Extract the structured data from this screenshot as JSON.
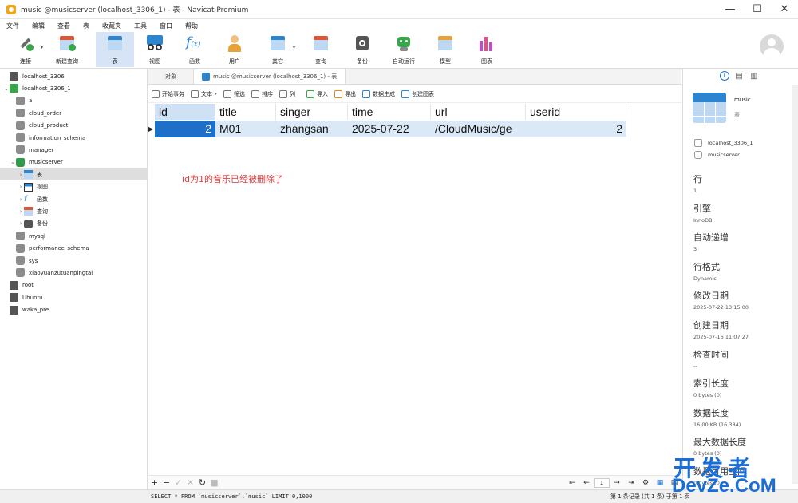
{
  "window": {
    "title": "music @musicserver (localhost_3306_1) - 表 - Navicat Premium"
  },
  "menu": [
    "文件",
    "编辑",
    "查看",
    "表",
    "收藏夹",
    "工具",
    "窗口",
    "帮助"
  ],
  "toolbar": [
    {
      "label": "连接",
      "icon": "connect-icon",
      "dropdown": true
    },
    {
      "label": "新建查询",
      "icon": "new-query-icon"
    },
    {
      "label": "表",
      "icon": "table-icon",
      "active": true
    },
    {
      "label": "视图",
      "icon": "view-icon"
    },
    {
      "label": "函数",
      "icon": "function-icon"
    },
    {
      "label": "用户",
      "icon": "user-icon"
    },
    {
      "label": "其它",
      "icon": "tools-icon",
      "dropdown": true
    },
    {
      "label": "查询",
      "icon": "query-icon"
    },
    {
      "label": "备份",
      "icon": "backup-icon"
    },
    {
      "label": "自动运行",
      "icon": "robot-icon"
    },
    {
      "label": "模型",
      "icon": "model-icon"
    },
    {
      "label": "图表",
      "icon": "chart-icon"
    }
  ],
  "tree": [
    {
      "label": "localhost_3306",
      "type": "conn",
      "indent": 0
    },
    {
      "label": "localhost_3306_1",
      "type": "conn-open",
      "indent": 0,
      "chev": "⌄"
    },
    {
      "label": "a",
      "type": "db",
      "indent": 1
    },
    {
      "label": "cloud_order",
      "type": "db",
      "indent": 1
    },
    {
      "label": "cloud_product",
      "type": "db",
      "indent": 1
    },
    {
      "label": "information_schema",
      "type": "db",
      "indent": 1
    },
    {
      "label": "manager",
      "type": "db",
      "indent": 1
    },
    {
      "label": "musicserver",
      "type": "db-open",
      "indent": 1,
      "chev": "⌄"
    },
    {
      "label": "表",
      "type": "tables",
      "indent": 2,
      "chev": "›",
      "selected": true
    },
    {
      "label": "视图",
      "type": "views",
      "indent": 2,
      "chev": "›"
    },
    {
      "label": "函数",
      "type": "funcs",
      "indent": 2,
      "chev": "›"
    },
    {
      "label": "查询",
      "type": "queries",
      "indent": 2,
      "chev": "›"
    },
    {
      "label": "备份",
      "type": "backups",
      "indent": 2,
      "chev": "›"
    },
    {
      "label": "mysql",
      "type": "db",
      "indent": 1
    },
    {
      "label": "performance_schema",
      "type": "db",
      "indent": 1
    },
    {
      "label": "sys",
      "type": "db",
      "indent": 1
    },
    {
      "label": "xiaoyuanzutuanpingtai",
      "type": "db",
      "indent": 1
    },
    {
      "label": "root",
      "type": "conn",
      "indent": 0
    },
    {
      "label": "Ubuntu",
      "type": "conn",
      "indent": 0
    },
    {
      "label": "waka_pre",
      "type": "conn",
      "indent": 0
    }
  ],
  "tabs": {
    "objects": "对象",
    "active": "music @musicserver (localhost_3306_1) - 表"
  },
  "subtoolbar": [
    {
      "label": "开始事务",
      "icon": "transaction-icon",
      "color": "#777"
    },
    {
      "label": "文本",
      "icon": "text-icon",
      "color": "#777",
      "dropdown": true
    },
    {
      "label": "筛选",
      "icon": "filter-icon",
      "color": "#777"
    },
    {
      "label": "排序",
      "icon": "sort-icon",
      "color": "#777"
    },
    {
      "label": "列",
      "icon": "columns-icon",
      "color": "#777"
    },
    {
      "label": "导入",
      "icon": "import-icon",
      "color": "#3aa64c"
    },
    {
      "label": "导出",
      "icon": "export-icon",
      "color": "#e08a1e"
    },
    {
      "label": "数据生成",
      "icon": "data-gen-icon",
      "color": "#2d84cf"
    },
    {
      "label": "创建图表",
      "icon": "create-chart-icon",
      "color": "#2d84cf"
    }
  ],
  "grid": {
    "columns": [
      "id",
      "title",
      "singer",
      "time",
      "url",
      "userid"
    ],
    "rows": [
      [
        "2",
        "M01",
        "zhangsan",
        "2025-07-22",
        "/CloudMusic/ge",
        "2"
      ]
    ]
  },
  "note": "id为1的音乐已经被删除了",
  "info": {
    "name": "music",
    "type": "表",
    "connection": "localhost_3306_1",
    "database": "musicserver",
    "props": [
      {
        "label": "行",
        "value": "1"
      },
      {
        "label": "引擎",
        "value": "InnoDB"
      },
      {
        "label": "自动递增",
        "value": "3"
      },
      {
        "label": "行格式",
        "value": "Dynamic"
      },
      {
        "label": "修改日期",
        "value": "2025-07-22 13:15:00"
      },
      {
        "label": "创建日期",
        "value": "2025-07-16 11:07:27"
      },
      {
        "label": "检查时间",
        "value": "--"
      },
      {
        "label": "索引长度",
        "value": "0 bytes (0)"
      },
      {
        "label": "数据长度",
        "value": "16.00 KB (16,384)"
      },
      {
        "label": "最大数据长度",
        "value": "0 bytes (0)"
      },
      {
        "label": "数据可用空间",
        "value": "0 bytes (0)"
      }
    ]
  },
  "pager": {
    "page": "1"
  },
  "status": {
    "sql": "SELECT * FROM `musicserver`.`music` LIMIT 0,1000",
    "records": "第 1 条记录 (共 1 条) 于第 1 页"
  },
  "watermark": {
    "line1": "开发者",
    "line2": "DevZe.CoM"
  },
  "colors": {
    "accent": "#1e6fc7",
    "note": "#e33a3a",
    "selectedRow": "#dbe9f7"
  }
}
